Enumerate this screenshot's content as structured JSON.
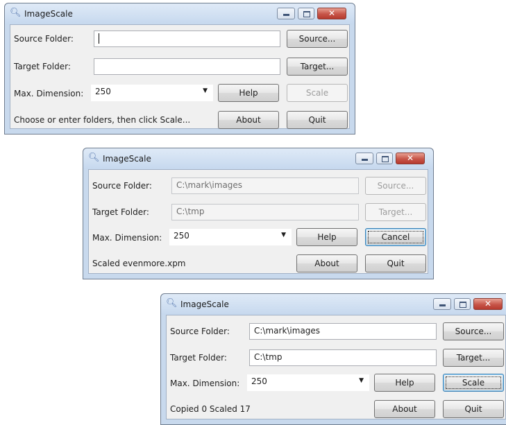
{
  "windows": [
    {
      "title": "ImageScale",
      "source_label": "Source Folder:",
      "target_label": "Target Folder:",
      "dimension_label": "Max. Dimension:",
      "source_value": "",
      "target_value": "",
      "dimension_value": "250",
      "status": "Choose or enter folders, then click Scale...",
      "buttons": {
        "source": "Source...",
        "target": "Target...",
        "help": "Help",
        "scale": "Scale",
        "about": "About",
        "quit": "Quit"
      }
    },
    {
      "title": "ImageScale",
      "source_label": "Source Folder:",
      "target_label": "Target Folder:",
      "dimension_label": "Max. Dimension:",
      "source_value": "C:\\mark\\images",
      "target_value": "C:\\tmp",
      "dimension_value": "250",
      "status": "Scaled evenmore.xpm",
      "buttons": {
        "source": "Source...",
        "target": "Target...",
        "help": "Help",
        "cancel": "Cancel",
        "about": "About",
        "quit": "Quit"
      }
    },
    {
      "title": "ImageScale",
      "source_label": "Source Folder:",
      "target_label": "Target Folder:",
      "dimension_label": "Max. Dimension:",
      "source_value": "C:\\mark\\images",
      "target_value": "C:\\tmp",
      "dimension_value": "250",
      "status": "Copied 0 Scaled 17",
      "buttons": {
        "source": "Source...",
        "target": "Target...",
        "help": "Help",
        "scale": "Scale",
        "about": "About",
        "quit": "Quit"
      }
    }
  ],
  "icons": {
    "app": "magnifier-icon",
    "minimize": "minimize-icon",
    "maximize": "maximize-icon",
    "close": "close-icon",
    "dropdown": "chevron-down-icon"
  },
  "colors": {
    "titlebar": "#c8d9ed",
    "close_button": "#c75549",
    "client_bg": "#f0f0f0"
  }
}
